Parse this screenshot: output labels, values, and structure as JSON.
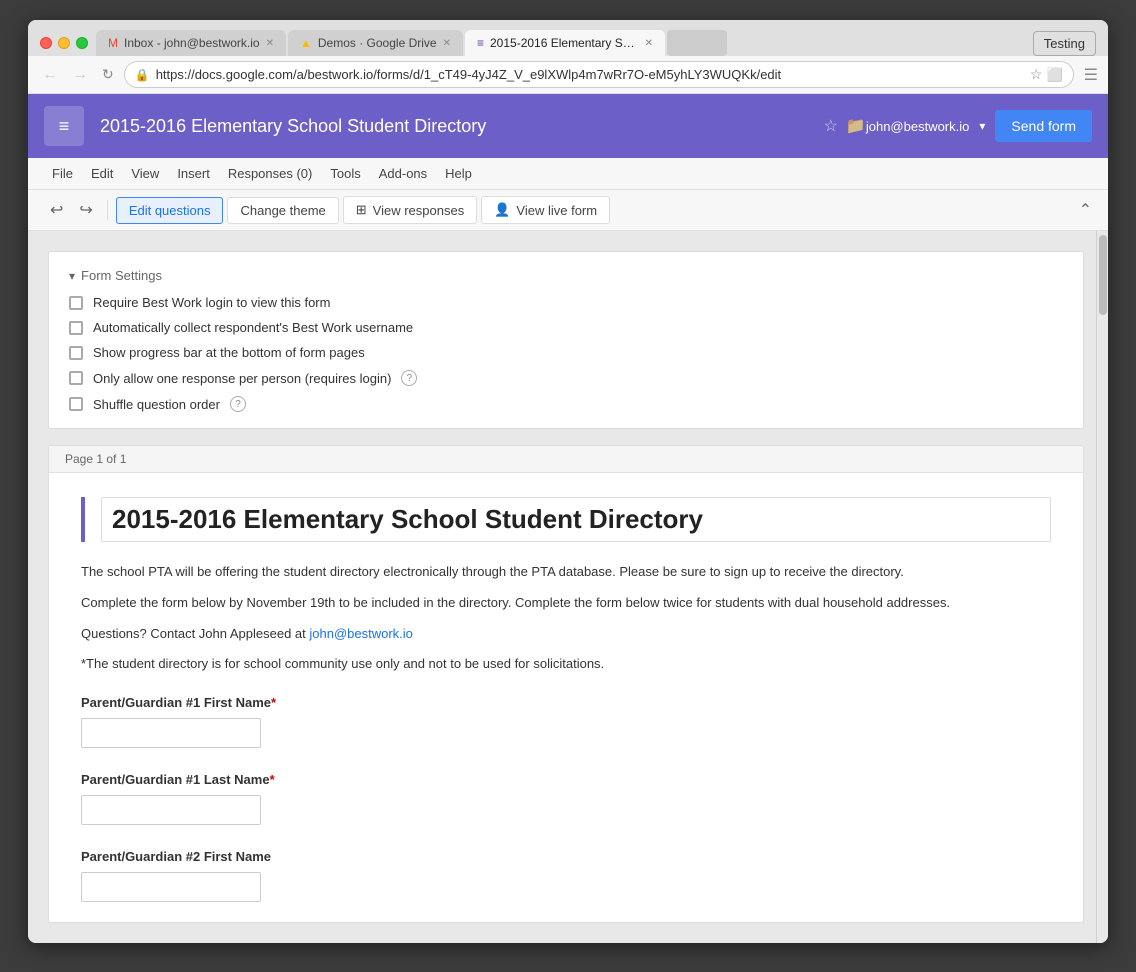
{
  "browser": {
    "testing_label": "Testing",
    "tabs": [
      {
        "id": "tab-gmail",
        "icon": "✉",
        "icon_color": "#EA4335",
        "label": "Inbox - john@bestwork.io",
        "active": false
      },
      {
        "id": "tab-drive",
        "icon": "▲",
        "icon_color": "#FBBC05",
        "label": "Demos · Google Drive",
        "active": false
      },
      {
        "id": "tab-forms",
        "icon": "≡",
        "icon_color": "#673AB7",
        "label": "2015-2016 Elementary Sc…",
        "active": true
      }
    ],
    "url": "https://docs.google.com/a/bestwork.io/forms/d/1_cT49-4yJ4Z_V_e9lXWlp4m7wRr7O-eM5yhLY3WUQKk/edit"
  },
  "app": {
    "logo_icon": "≡",
    "title": "2015-2016 Elementary School Student Directory",
    "user_email": "john@bestwork.io",
    "send_form_label": "Send form"
  },
  "menu": {
    "items": [
      "File",
      "Edit",
      "View",
      "Insert",
      "Responses (0)",
      "Tools",
      "Add-ons",
      "Help"
    ]
  },
  "toolbar": {
    "undo_icon": "↩",
    "redo_icon": "↪",
    "edit_questions_label": "Edit questions",
    "change_theme_label": "Change theme",
    "view_responses_label": "View responses",
    "view_responses_icon": "⊞",
    "view_live_form_label": "View live form",
    "view_live_form_icon": "👤",
    "collapse_icon": "⌃"
  },
  "form_settings": {
    "header": "Form Settings",
    "toggle_icon": "▾",
    "items": [
      {
        "label": "Require Best Work login to view this form",
        "checked": false,
        "has_help": false
      },
      {
        "label": "Automatically collect respondent's Best Work username",
        "checked": false,
        "has_help": false
      },
      {
        "label": "Show progress bar at the bottom of form pages",
        "checked": false,
        "has_help": false
      },
      {
        "label": "Only allow one response per person (requires login)",
        "checked": false,
        "has_help": true
      },
      {
        "label": "Shuffle question order",
        "checked": false,
        "has_help": true
      }
    ]
  },
  "form_page": {
    "page_label": "Page 1 of 1",
    "title": "2015-2016 Elementary School Student Directory",
    "description_lines": [
      "The school PTA will be offering the student directory electronically through the PTA database.  Please be sure to sign up to receive the directory.",
      "Complete the form below by November 19th to be included in the directory.  Complete the form below twice for students with dual household addresses.",
      "Questions? Contact John Appleseed at john@bestwork.io",
      "*The student directory is for school community use only and not to be used for solicitations."
    ],
    "contact_email": "john@bestwork.io",
    "fields": [
      {
        "label": "Parent/Guardian #1 First Name",
        "required": true
      },
      {
        "label": "Parent/Guardian #1 Last Name",
        "required": true
      },
      {
        "label": "Parent/Guardian #2 First Name",
        "required": false
      }
    ]
  }
}
